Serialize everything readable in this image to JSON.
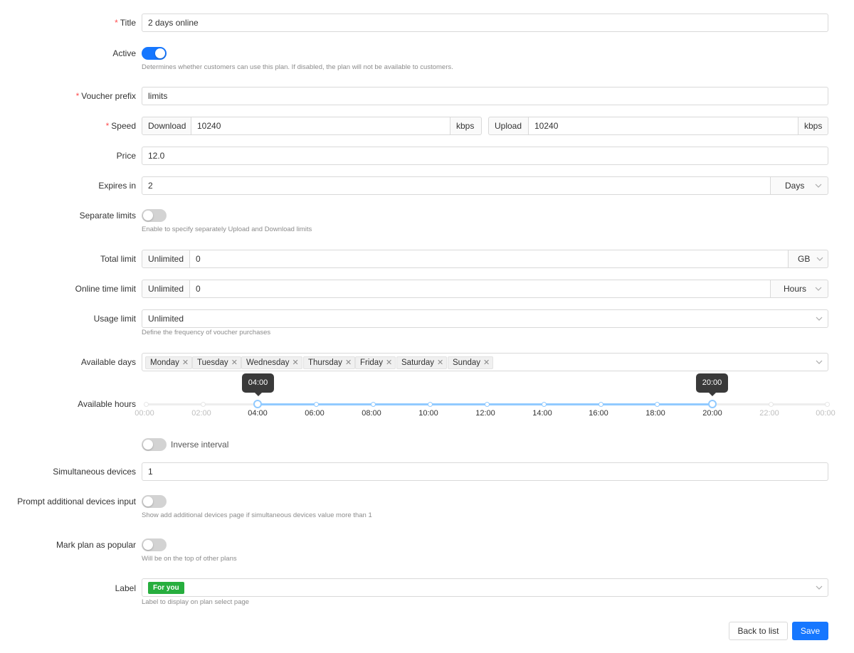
{
  "form": {
    "title": {
      "label": "Title",
      "value": "2 days online"
    },
    "active": {
      "label": "Active",
      "on": true,
      "help": "Determines whether customers can use this plan. If disabled, the plan will not be available to customers."
    },
    "voucher_prefix": {
      "label": "Voucher prefix",
      "value": "limits"
    },
    "speed": {
      "label": "Speed",
      "download_label": "Download",
      "download_value": "10240",
      "download_unit": "kbps",
      "upload_label": "Upload",
      "upload_value": "10240",
      "upload_unit": "kbps"
    },
    "price": {
      "label": "Price",
      "value": "12.0"
    },
    "expires_in": {
      "label": "Expires in",
      "value": "2",
      "unit": "Days"
    },
    "separate_limits": {
      "label": "Separate limits",
      "on": false,
      "help": "Enable to specify separately Upload and Download limits"
    },
    "total_limit": {
      "label": "Total limit",
      "mode": "Unlimited",
      "value": "0",
      "unit": "GB"
    },
    "online_time_limit": {
      "label": "Online time limit",
      "mode": "Unlimited",
      "value": "0",
      "unit": "Hours"
    },
    "usage_limit": {
      "label": "Usage limit",
      "value": "Unlimited",
      "help": "Define the frequency of voucher purchases"
    },
    "available_days": {
      "label": "Available days",
      "days": [
        "Monday",
        "Tuesday",
        "Wednesday",
        "Thursday",
        "Friday",
        "Saturday",
        "Sunday"
      ]
    },
    "available_hours": {
      "label": "Available hours",
      "start": "04:00",
      "end": "20:00",
      "ticks": [
        "00:00",
        "02:00",
        "04:00",
        "06:00",
        "08:00",
        "10:00",
        "12:00",
        "14:00",
        "16:00",
        "18:00",
        "20:00",
        "22:00",
        "00:00"
      ]
    },
    "inverse_interval": {
      "label": "Inverse interval",
      "on": false
    },
    "simultaneous_devices": {
      "label": "Simultaneous devices",
      "value": "1"
    },
    "prompt_additional_devices": {
      "label": "Prompt additional devices input",
      "on": false,
      "help": "Show add additional devices page if simultaneous devices value more than 1"
    },
    "mark_popular": {
      "label": "Mark plan as popular",
      "on": false,
      "help": "Will be on the top of other plans"
    },
    "plan_label": {
      "label": "Label",
      "value": "For you",
      "color": "#27ae3e",
      "help": "Label to display on plan select page"
    }
  },
  "actions": {
    "back": "Back to list",
    "save": "Save"
  },
  "colors": {
    "primary": "#1677ff",
    "required": "#ff4d4f",
    "slider": "#91caff"
  }
}
